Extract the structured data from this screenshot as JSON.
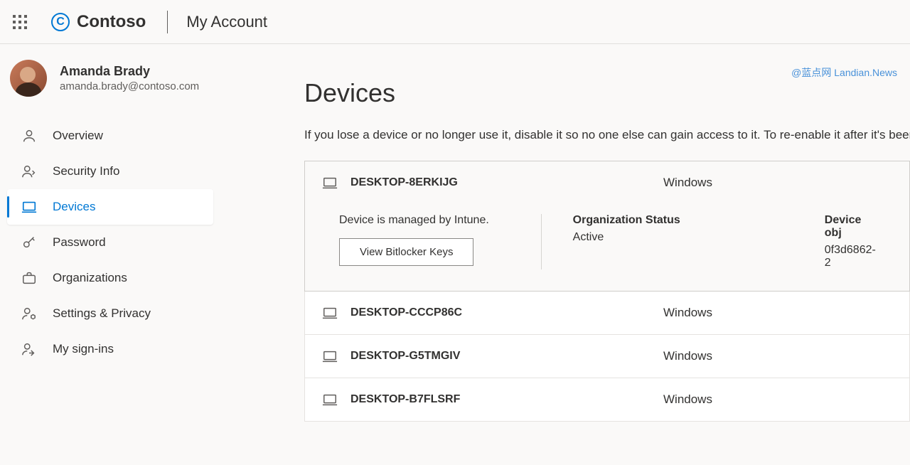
{
  "header": {
    "org_name": "Contoso",
    "section_title": "My Account"
  },
  "user": {
    "name": "Amanda Brady",
    "email": "amanda.brady@contoso.com"
  },
  "sidebar": {
    "items": [
      {
        "id": "overview",
        "label": "Overview"
      },
      {
        "id": "security-info",
        "label": "Security Info"
      },
      {
        "id": "devices",
        "label": "Devices"
      },
      {
        "id": "password",
        "label": "Password"
      },
      {
        "id": "organizations",
        "label": "Organizations"
      },
      {
        "id": "settings-privacy",
        "label": "Settings & Privacy"
      },
      {
        "id": "my-sign-ins",
        "label": "My sign-ins"
      }
    ],
    "active_id": "devices"
  },
  "page": {
    "title": "Devices",
    "description": "If you lose a device or no longer use it, disable it so no one else can gain access to it. To re-enable it after it's been disab"
  },
  "devices": [
    {
      "name": "DESKTOP-8ERKIJG",
      "os": "Windows",
      "expanded": true,
      "managed_text": "Device is managed by Intune.",
      "bitlocker_button": "View Bitlocker Keys",
      "org_status_label": "Organization Status",
      "org_status_value": "Active",
      "object_label": "Device obj",
      "object_value": "0f3d6862-2"
    },
    {
      "name": "DESKTOP-CCCP86C",
      "os": "Windows",
      "expanded": false
    },
    {
      "name": "DESKTOP-G5TMGIV",
      "os": "Windows",
      "expanded": false
    },
    {
      "name": "DESKTOP-B7FLSRF",
      "os": "Windows",
      "expanded": false
    }
  ],
  "watermark": "@蓝点网 Landian.News"
}
